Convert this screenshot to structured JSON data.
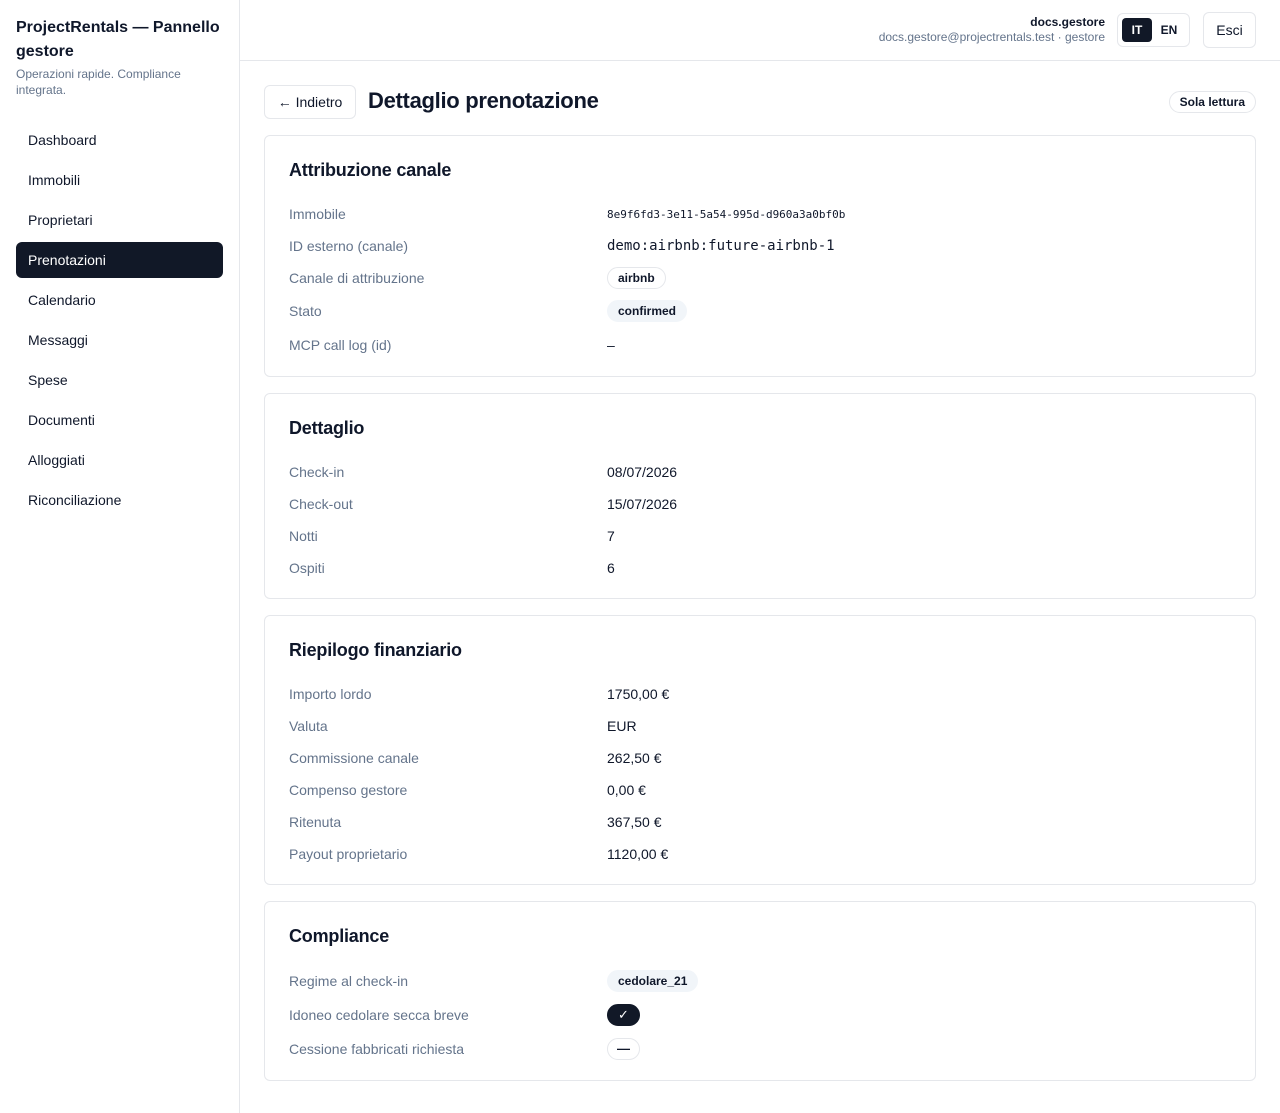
{
  "brand": {
    "title": "ProjectRentals — Pannello gestore",
    "subtitle": "Operazioni rapide. Compliance integrata."
  },
  "nav": {
    "items": [
      {
        "label": "Dashboard"
      },
      {
        "label": "Immobili"
      },
      {
        "label": "Proprietari"
      },
      {
        "label": "Prenotazioni",
        "active": true
      },
      {
        "label": "Calendario"
      },
      {
        "label": "Messaggi"
      },
      {
        "label": "Spese"
      },
      {
        "label": "Documenti"
      },
      {
        "label": "Alloggiati"
      },
      {
        "label": "Riconciliazione"
      }
    ]
  },
  "topbar": {
    "user_name": "docs.gestore",
    "user_meta": "docs.gestore@projectrentals.test · gestore",
    "lang_it": "IT",
    "lang_en": "EN",
    "active_lang": "IT",
    "logout_label": "Esci"
  },
  "page": {
    "back_label": "← Indietro",
    "title": "Dettaglio prenotazione",
    "readonly_badge": "Sola lettura"
  },
  "attribution": {
    "title": "Attribuzione canale",
    "property_label": "Immobile",
    "property_value": "8e9f6fd3-3e11-5a54-995d-d960a3a0bf0b",
    "external_id_label": "ID esterno (canale)",
    "external_id_value": "demo:airbnb:future-airbnb-1",
    "channel_label": "Canale di attribuzione",
    "channel_value": "airbnb",
    "status_label": "Stato",
    "status_value": "confirmed",
    "mcp_label": "MCP call log (id)",
    "mcp_value": "–"
  },
  "detail": {
    "title": "Dettaglio",
    "checkin_label": "Check-in",
    "checkin_value": "08/07/2026",
    "checkout_label": "Check-out",
    "checkout_value": "15/07/2026",
    "nights_label": "Notti",
    "nights_value": "7",
    "guests_label": "Ospiti",
    "guests_value": "6"
  },
  "finance": {
    "title": "Riepilogo finanziario",
    "gross_label": "Importo lordo",
    "gross_value": "1750,00 €",
    "currency_label": "Valuta",
    "currency_value": "EUR",
    "channel_fee_label": "Commissione canale",
    "channel_fee_value": "262,50 €",
    "manager_fee_label": "Compenso gestore",
    "manager_fee_value": "0,00 €",
    "withholding_label": "Ritenuta",
    "withholding_value": "367,50 €",
    "payout_label": "Payout proprietario",
    "payout_value": "1120,00 €"
  },
  "compliance": {
    "title": "Compliance",
    "regime_label": "Regime al check-in",
    "regime_value": "cedolare_21",
    "eligible_label": "Idoneo cedolare secca breve",
    "eligible_value": "✓",
    "cession_label": "Cessione fabbricati richiesta",
    "cession_value": "—"
  },
  "colors": {
    "primary_dark": "#111827",
    "muted_text": "#64748b",
    "border": "#e5e7eb",
    "pill_bg": "#f1f5f9"
  }
}
